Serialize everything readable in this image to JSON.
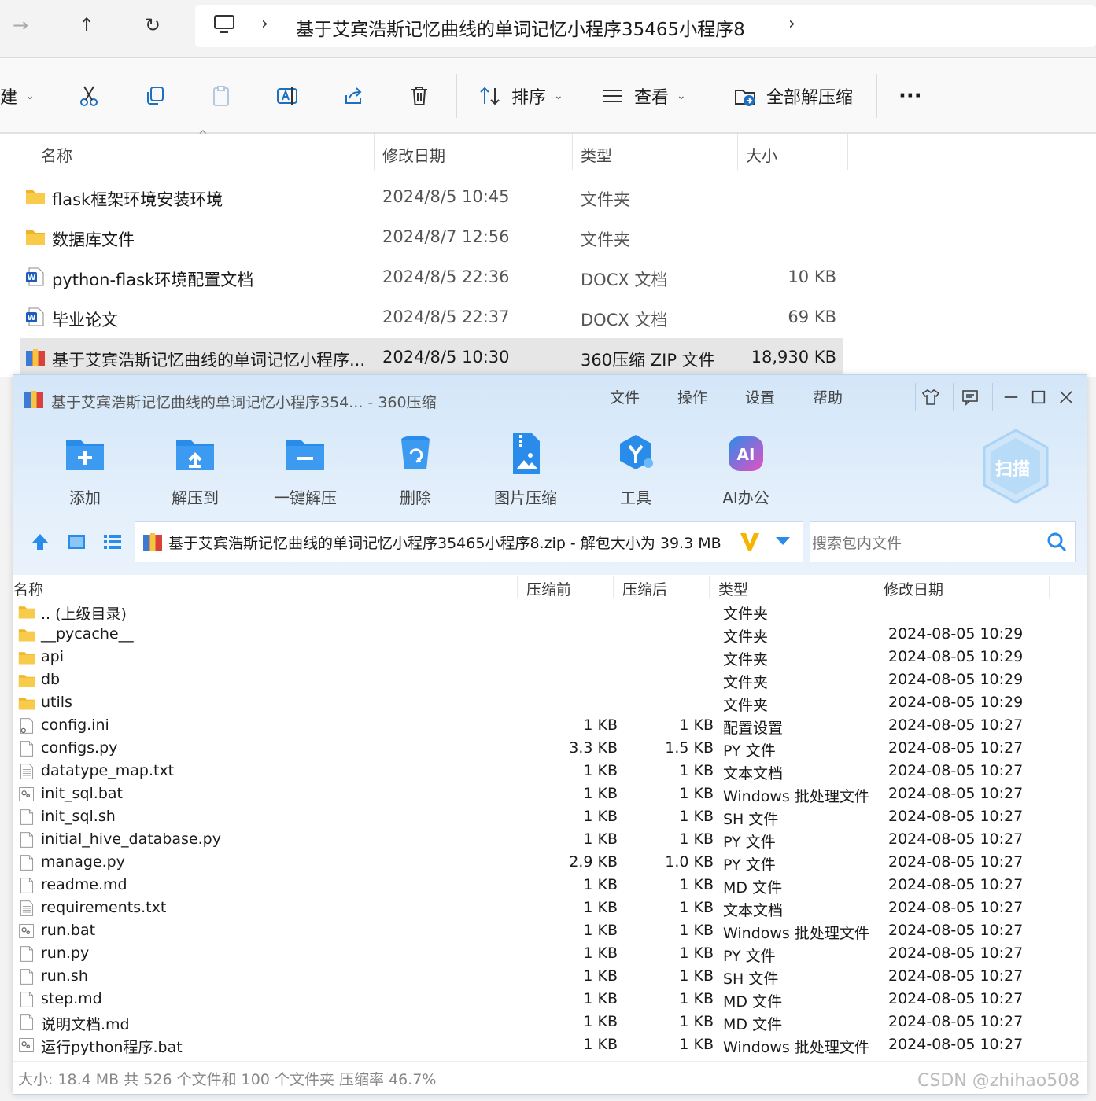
{
  "explorer": {
    "address_path": "基于艾宾浩斯记忆曲线的单词记忆小程序35465小程序8",
    "toolbar": {
      "new_partial": "建",
      "sort_label": "排序",
      "view_label": "查看",
      "extract_all_label": "全部解压缩",
      "more_label": "···"
    },
    "columns": {
      "name": "名称",
      "modified": "修改日期",
      "type": "类型",
      "size": "大小"
    },
    "files": [
      {
        "name": "flask框架环境安装环境",
        "modified": "2024/8/5 10:45",
        "type": "文件夹",
        "size": "",
        "icon": "folder-icon"
      },
      {
        "name": "数据库文件",
        "modified": "2024/8/7 12:56",
        "type": "文件夹",
        "size": "",
        "icon": "folder-icon"
      },
      {
        "name": "python-flask环境配置文档",
        "modified": "2024/8/5 22:36",
        "type": "DOCX 文档",
        "size": "10 KB",
        "icon": "word-doc-icon"
      },
      {
        "name": "毕业论文",
        "modified": "2024/8/5 22:37",
        "type": "DOCX 文档",
        "size": "69 KB",
        "icon": "word-doc-icon"
      },
      {
        "name": "基于艾宾浩斯记忆曲线的单词记忆小程序...",
        "modified": "2024/8/5 10:30",
        "type": "360压缩 ZIP 文件",
        "size": "18,930 KB",
        "icon": "zip-archive-icon",
        "selected": true
      }
    ]
  },
  "zip": {
    "title": "基于艾宾浩斯记忆曲线的单词记忆小程序354... - 360压缩",
    "menu": [
      "文件",
      "操作",
      "设置",
      "帮助"
    ],
    "tools": [
      "添加",
      "解压到",
      "一键解压",
      "删除",
      "图片压缩",
      "工具",
      "AI办公"
    ],
    "scan_label": "扫描",
    "path": "基于艾宾浩斯记忆曲线的单词记忆小程序35465小程序8.zip - 解包大小为 39.3 MB",
    "search_placeholder": "搜索包内文件",
    "columns": {
      "name": "名称",
      "before": "压缩前",
      "after": "压缩后",
      "type": "类型",
      "date": "修改日期"
    },
    "rows": [
      {
        "name": ".. (上级目录)",
        "before": "",
        "after": "",
        "type": "文件夹",
        "date": "",
        "icon": "folder-icon"
      },
      {
        "name": "__pycache__",
        "before": "",
        "after": "",
        "type": "文件夹",
        "date": "2024-08-05 10:29",
        "icon": "folder-icon"
      },
      {
        "name": "api",
        "before": "",
        "after": "",
        "type": "文件夹",
        "date": "2024-08-05 10:29",
        "icon": "folder-icon"
      },
      {
        "name": "db",
        "before": "",
        "after": "",
        "type": "文件夹",
        "date": "2024-08-05 10:29",
        "icon": "folder-icon"
      },
      {
        "name": "utils",
        "before": "",
        "after": "",
        "type": "文件夹",
        "date": "2024-08-05 10:29",
        "icon": "folder-icon"
      },
      {
        "name": "config.ini",
        "before": "1 KB",
        "after": "1 KB",
        "type": "配置设置",
        "date": "2024-08-05 10:27",
        "icon": "config-file-icon"
      },
      {
        "name": "configs.py",
        "before": "3.3 KB",
        "after": "1.5 KB",
        "type": "PY 文件",
        "date": "2024-08-05 10:27",
        "icon": "blank-file-icon"
      },
      {
        "name": "datatype_map.txt",
        "before": "1 KB",
        "after": "1 KB",
        "type": "文本文档",
        "date": "2024-08-05 10:27",
        "icon": "text-file-icon"
      },
      {
        "name": "init_sql.bat",
        "before": "1 KB",
        "after": "1 KB",
        "type": "Windows 批处理文件",
        "date": "2024-08-05 10:27",
        "icon": "batch-file-icon"
      },
      {
        "name": "init_sql.sh",
        "before": "1 KB",
        "after": "1 KB",
        "type": "SH 文件",
        "date": "2024-08-05 10:27",
        "icon": "blank-file-icon"
      },
      {
        "name": "initial_hive_database.py",
        "before": "1 KB",
        "after": "1 KB",
        "type": "PY 文件",
        "date": "2024-08-05 10:27",
        "icon": "blank-file-icon"
      },
      {
        "name": "manage.py",
        "before": "2.9 KB",
        "after": "1.0 KB",
        "type": "PY 文件",
        "date": "2024-08-05 10:27",
        "icon": "blank-file-icon"
      },
      {
        "name": "readme.md",
        "before": "1 KB",
        "after": "1 KB",
        "type": "MD 文件",
        "date": "2024-08-05 10:27",
        "icon": "blank-file-icon"
      },
      {
        "name": "requirements.txt",
        "before": "1 KB",
        "after": "1 KB",
        "type": "文本文档",
        "date": "2024-08-05 10:27",
        "icon": "text-file-icon"
      },
      {
        "name": "run.bat",
        "before": "1 KB",
        "after": "1 KB",
        "type": "Windows 批处理文件",
        "date": "2024-08-05 10:27",
        "icon": "batch-file-icon"
      },
      {
        "name": "run.py",
        "before": "1 KB",
        "after": "1 KB",
        "type": "PY 文件",
        "date": "2024-08-05 10:27",
        "icon": "blank-file-icon"
      },
      {
        "name": "run.sh",
        "before": "1 KB",
        "after": "1 KB",
        "type": "SH 文件",
        "date": "2024-08-05 10:27",
        "icon": "blank-file-icon"
      },
      {
        "name": "step.md",
        "before": "1 KB",
        "after": "1 KB",
        "type": "MD 文件",
        "date": "2024-08-05 10:27",
        "icon": "blank-file-icon"
      },
      {
        "name": "说明文档.md",
        "before": "1 KB",
        "after": "1 KB",
        "type": "MD 文件",
        "date": "2024-08-05 10:27",
        "icon": "blank-file-icon"
      },
      {
        "name": "运行python程序.bat",
        "before": "1 KB",
        "after": "1 KB",
        "type": "Windows 批处理文件",
        "date": "2024-08-05 10:27",
        "icon": "batch-file-icon"
      }
    ],
    "status": "大小: 18.4 MB 共 526 个文件和 100 个文件夹 压缩率 46.7%"
  },
  "watermark": "CSDN @zhihao508",
  "colors": {
    "accent_blue": "#2a8cea",
    "folder_yellow": "#f5c33b",
    "selection_gray": "#e6e6e6"
  }
}
